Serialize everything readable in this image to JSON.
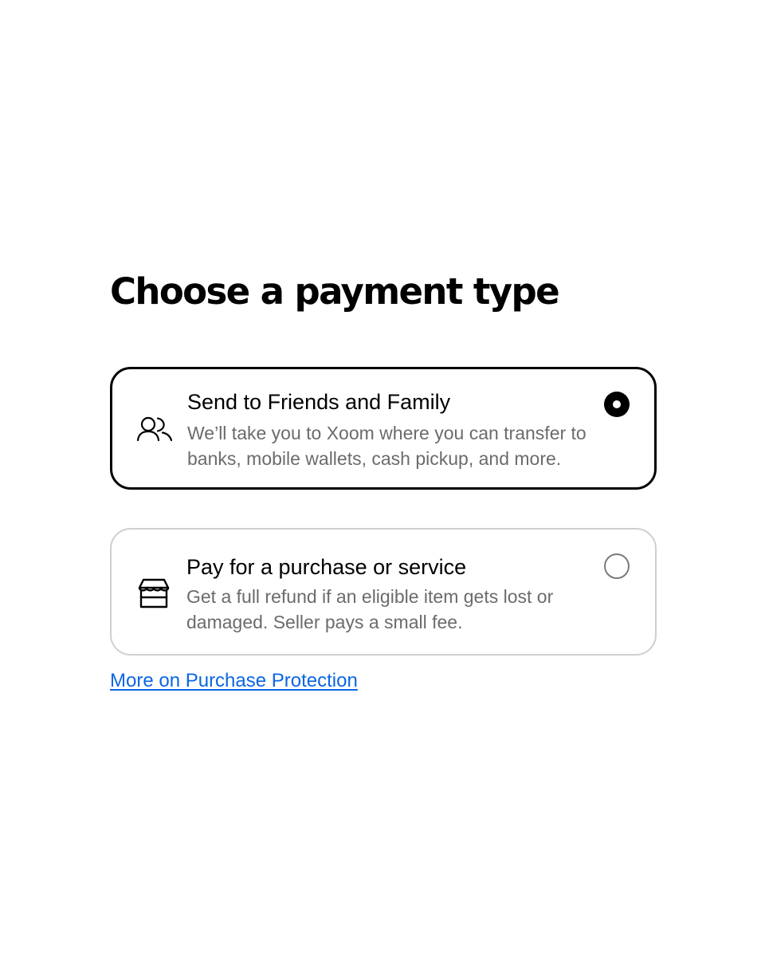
{
  "page": {
    "title": "Choose a payment type"
  },
  "options": [
    {
      "title": "Send to Friends and Family",
      "description": "We’ll take you to Xoom where you can transfer to banks, mobile wallets, cash pickup, and more.",
      "icon": "people-icon",
      "selected": true
    },
    {
      "title": "Pay for a purchase or service",
      "description": "Get a full refund if an eligible item gets lost or damaged. Seller pays a small fee.",
      "icon": "storefront-icon",
      "selected": false
    }
  ],
  "link": {
    "label": "More on Purchase Protection"
  },
  "colors": {
    "text": "#000000",
    "secondary_text": "#6b6b6b",
    "link": "#0b66e4",
    "unselected_border": "#cfcfcf"
  }
}
